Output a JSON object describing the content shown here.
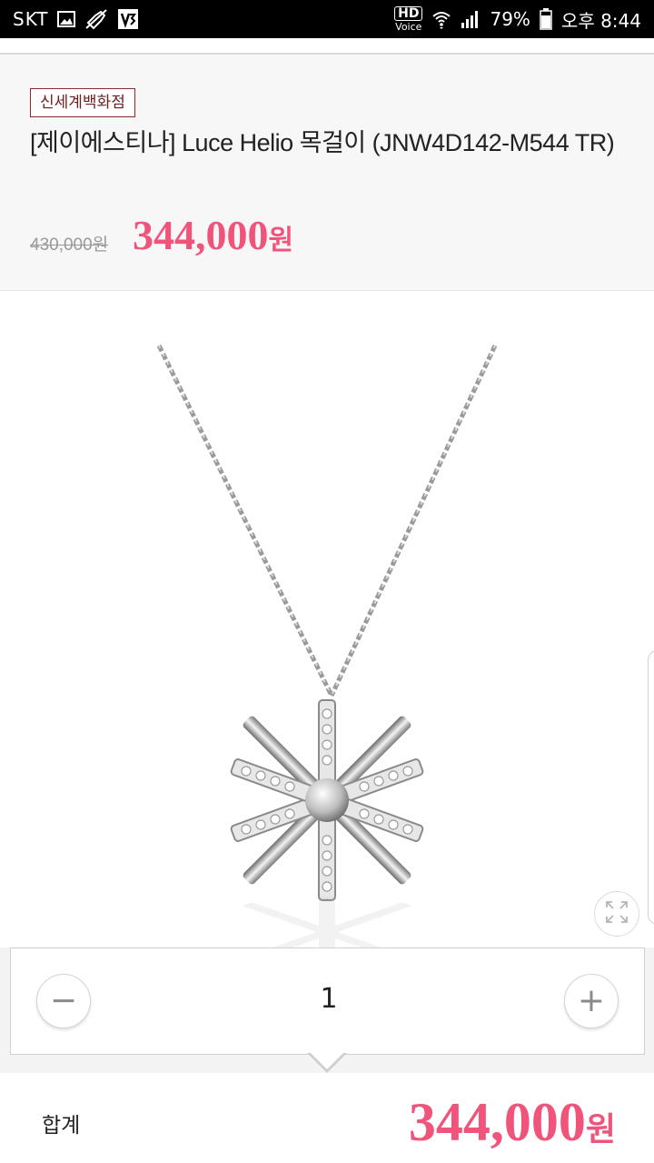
{
  "status_bar": {
    "carrier": "SKT",
    "hd": "HD",
    "voice": "Voice",
    "battery": "79%",
    "time": "오후 8:44",
    "icons": [
      "gallery-icon",
      "mute-icon",
      "v3-app-icon",
      "wifi-icon",
      "signal-icon",
      "battery-icon"
    ]
  },
  "product": {
    "store": "신세계백화점",
    "title": "[제이에스티나] Luce Helio 목걸이 (JNW4D142-M544 TR)",
    "original_price": "430,000원",
    "sale_price_number": "344,000",
    "currency": "원"
  },
  "image": {
    "subject": "necklace-pendant",
    "expand_icon": "expand-icon"
  },
  "quantity": {
    "minus_label": "−",
    "value": "1",
    "plus_label": "+"
  },
  "total": {
    "label": "합계",
    "price_number": "344,000",
    "currency": "원"
  },
  "colors": {
    "accent": "#f0547a",
    "badge_border": "#8b2a2a",
    "header_bg": "#f8f7f7"
  }
}
